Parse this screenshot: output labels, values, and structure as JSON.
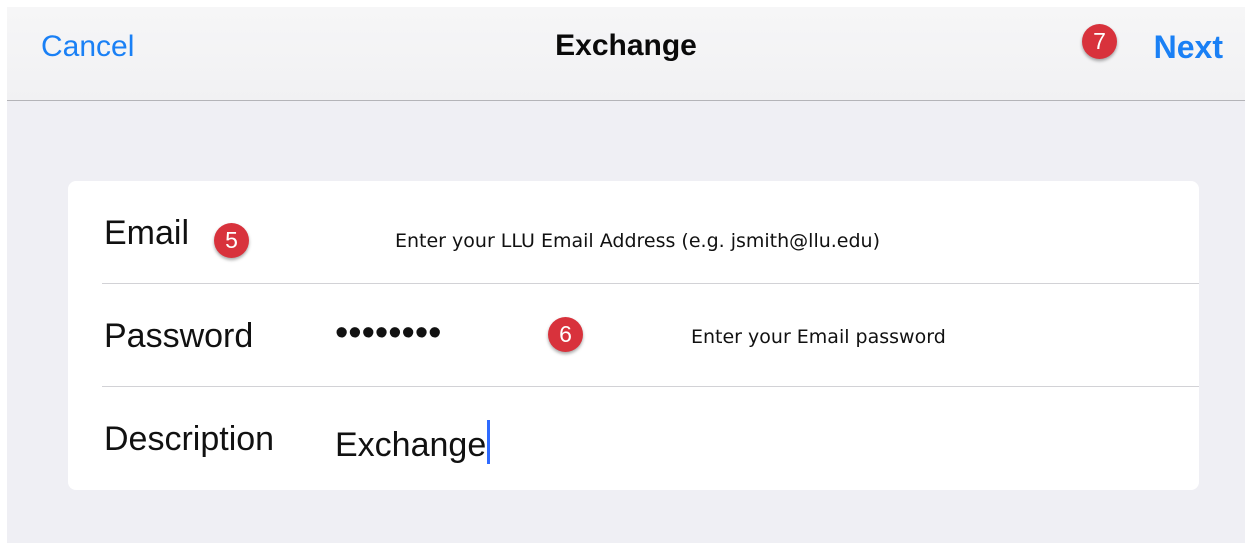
{
  "navbar": {
    "cancel_label": "Cancel",
    "title": "Exchange",
    "next_label": "Next"
  },
  "steps": {
    "email": "5",
    "password": "6",
    "next": "7"
  },
  "form": {
    "email": {
      "label": "Email",
      "hint": "Enter your LLU Email Address (e.g. jsmith@llu.edu)"
    },
    "password": {
      "label": "Password",
      "value": "••••••••",
      "hint": "Enter your Email password"
    },
    "description": {
      "label": "Description",
      "value": "Exchange"
    }
  },
  "colors": {
    "accent": "#1a80f5",
    "badge": "#d8323c",
    "background": "#efeff4",
    "caret": "#2f6bff"
  }
}
